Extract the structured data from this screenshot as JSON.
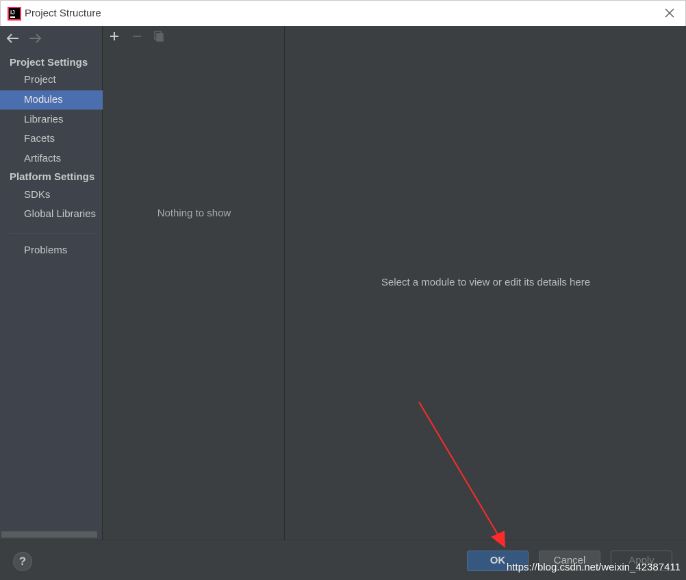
{
  "window": {
    "title": "Project Structure",
    "app_icon": "intellij-idea-icon",
    "close_icon": "close-icon"
  },
  "nav": {
    "back_icon": "arrow-left-icon",
    "forward_icon": "arrow-right-icon",
    "sections": [
      {
        "label": "Project Settings"
      },
      {
        "label": "Platform Settings"
      }
    ],
    "items": [
      {
        "label": "Project"
      },
      {
        "label": "Modules",
        "selected": true
      },
      {
        "label": "Libraries"
      },
      {
        "label": "Facets"
      },
      {
        "label": "Artifacts"
      },
      {
        "label": "SDKs"
      },
      {
        "label": "Global Libraries"
      },
      {
        "label": "Problems"
      }
    ]
  },
  "list_panel": {
    "toolbar": {
      "add_icon": "plus-icon",
      "remove_icon": "minus-icon",
      "copy_icon": "copy-icon"
    },
    "empty_text": "Nothing to show"
  },
  "details_panel": {
    "hint": "Select a module to view or edit its details here"
  },
  "buttons": {
    "help_label": "?",
    "ok_label": "OK",
    "cancel_label": "Cancel",
    "apply_label": "Apply"
  },
  "watermark": "https://blog.csdn.net/weixin_42387411",
  "colors": {
    "selection": "#4b6eaf",
    "annotation_arrow": "#ff2a2a",
    "ok_button": "#365880"
  }
}
